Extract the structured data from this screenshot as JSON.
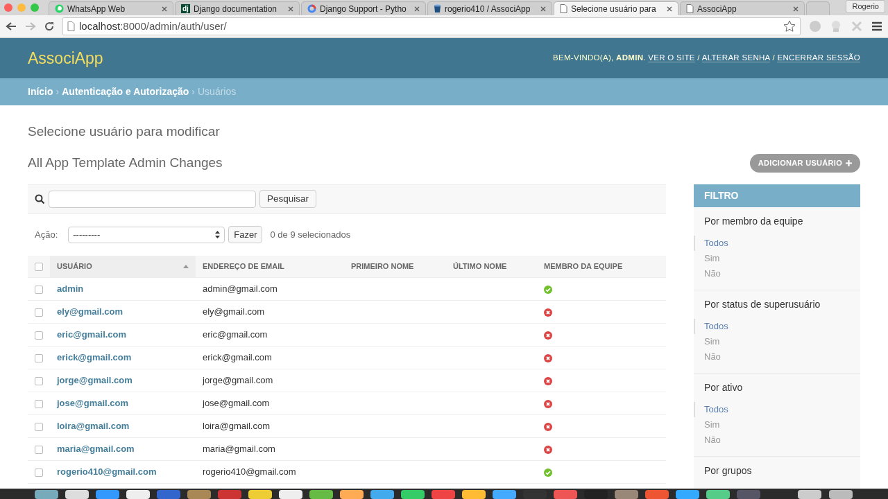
{
  "browser": {
    "tabs": [
      {
        "title": "WhatsApp Web",
        "kind": "chat",
        "selected": false
      },
      {
        "title": "Django documentation",
        "kind": "badge",
        "icon_text": "dj",
        "selected": false
      },
      {
        "title": "Django Support - Pytho",
        "kind": "ring",
        "selected": false
      },
      {
        "title": "rogerio410 / AssociApp",
        "kind": "bucket",
        "selected": false
      },
      {
        "title": "Selecione usuário para",
        "kind": "page",
        "selected": true
      },
      {
        "title": "AssociApp",
        "kind": "page",
        "selected": false
      }
    ],
    "profile": "Rogerio",
    "address_host": "localhost",
    "address_rest": ":8000/admin/auth/user/"
  },
  "header": {
    "brand": "AssociApp",
    "welcome": "BEM-VINDO(A),",
    "user": "ADMIN",
    "user_end": ".",
    "link_separator": "/",
    "links": [
      "VER O SITE",
      "ALTERAR SENHA",
      "ENCERRAR SESSÃO"
    ]
  },
  "breadcrumb_separator": "›",
  "breadcrumbs": [
    {
      "label": "Início",
      "current": false
    },
    {
      "label": "Autenticação e Autorização",
      "current": false
    },
    {
      "label": "Usuários",
      "current": true
    }
  ],
  "title": "Selecione usuário para modificar",
  "subtitle": "All App Template Admin Changes",
  "add_button": "ADICIONAR USUÁRIO",
  "search": {
    "button": "Pesquisar"
  },
  "actions": {
    "label": "Ação:",
    "select": "---------",
    "button": "Fazer",
    "counter": "0 de 9 selecionados"
  },
  "table": {
    "select_all_checked": false,
    "columns": [
      {
        "label": "USUÁRIO",
        "sorted": true
      },
      {
        "label": "ENDEREÇO DE EMAIL",
        "sorted": false
      },
      {
        "label": "PRIMEIRO NOME",
        "sorted": false
      },
      {
        "label": "ÚLTIMO NOME",
        "sorted": false
      },
      {
        "label": "MEMBRO DA EQUIPE",
        "sorted": false
      }
    ],
    "rows": [
      {
        "username": "admin",
        "email": "admin@gmail.com",
        "staff": true,
        "checked": false
      },
      {
        "username": "ely@gmail.com",
        "email": "ely@gmail.com",
        "staff": false,
        "checked": false
      },
      {
        "username": "eric@gmail.com",
        "email": "eric@gmail.com",
        "staff": false,
        "checked": false
      },
      {
        "username": "erick@gmail.com",
        "email": "erick@gmail.com",
        "staff": false,
        "checked": false
      },
      {
        "username": "jorge@gmail.com",
        "email": "jorge@gmail.com",
        "staff": false,
        "checked": false
      },
      {
        "username": "jose@gmail.com",
        "email": "jose@gmail.com",
        "staff": false,
        "checked": false
      },
      {
        "username": "loira@gmail.com",
        "email": "loira@gmail.com",
        "staff": false,
        "checked": false
      },
      {
        "username": "maria@gmail.com",
        "email": "maria@gmail.com",
        "staff": false,
        "checked": false
      },
      {
        "username": "rogerio410@gmail.com",
        "email": "rogerio410@gmail.com",
        "staff": true,
        "checked": false
      }
    ]
  },
  "filter": {
    "title": "FILTRO",
    "groups": [
      {
        "title": "Por membro da equipe",
        "options": [
          {
            "label": "Todos",
            "selected": true
          },
          {
            "label": "Sim",
            "selected": false
          },
          {
            "label": "Não",
            "selected": false
          }
        ]
      },
      {
        "title": "Por status de superusuário",
        "options": [
          {
            "label": "Todos",
            "selected": true
          },
          {
            "label": "Sim",
            "selected": false
          },
          {
            "label": "Não",
            "selected": false
          }
        ]
      },
      {
        "title": "Por ativo",
        "options": [
          {
            "label": "Todos",
            "selected": true
          },
          {
            "label": "Sim",
            "selected": false
          },
          {
            "label": "Não",
            "selected": false
          }
        ]
      },
      {
        "title": "Por grupos"
      }
    ]
  }
}
